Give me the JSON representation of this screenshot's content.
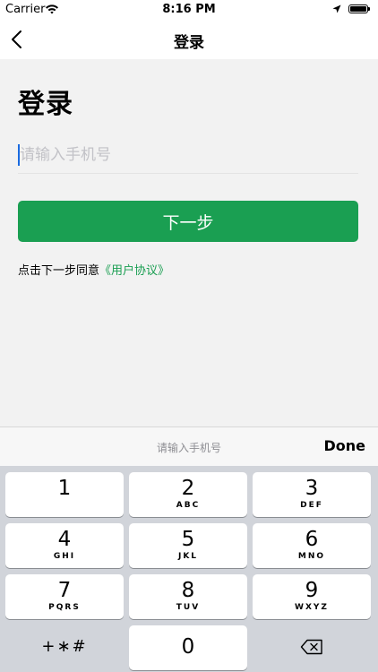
{
  "status_bar": {
    "carrier": "Carrier",
    "time": "8:16 PM",
    "icons": [
      "wifi-icon",
      "location-arrow-icon",
      "battery-icon"
    ]
  },
  "nav": {
    "title": "登录",
    "back_icon": "chevron-left-icon"
  },
  "page": {
    "heading": "登录",
    "phone_placeholder": "请输入手机号",
    "phone_value": "",
    "next_button": "下一步",
    "agreement_prefix": "点击下一步同意",
    "agreement_link": "《用户协议》",
    "accent_color": "#1a9f52"
  },
  "keyboard": {
    "accessory_hint": "请输入手机号",
    "done_label": "Done",
    "keys": [
      {
        "digit": "1",
        "letters": ""
      },
      {
        "digit": "2",
        "letters": "ABC"
      },
      {
        "digit": "3",
        "letters": "DEF"
      },
      {
        "digit": "4",
        "letters": "GHI"
      },
      {
        "digit": "5",
        "letters": "JKL"
      },
      {
        "digit": "6",
        "letters": "MNO"
      },
      {
        "digit": "7",
        "letters": "PQRS"
      },
      {
        "digit": "8",
        "letters": "TUV"
      },
      {
        "digit": "9",
        "letters": "WXYZ"
      }
    ],
    "symbols_key": "+∗#",
    "zero_key": "0",
    "delete_icon": "backspace-icon"
  }
}
